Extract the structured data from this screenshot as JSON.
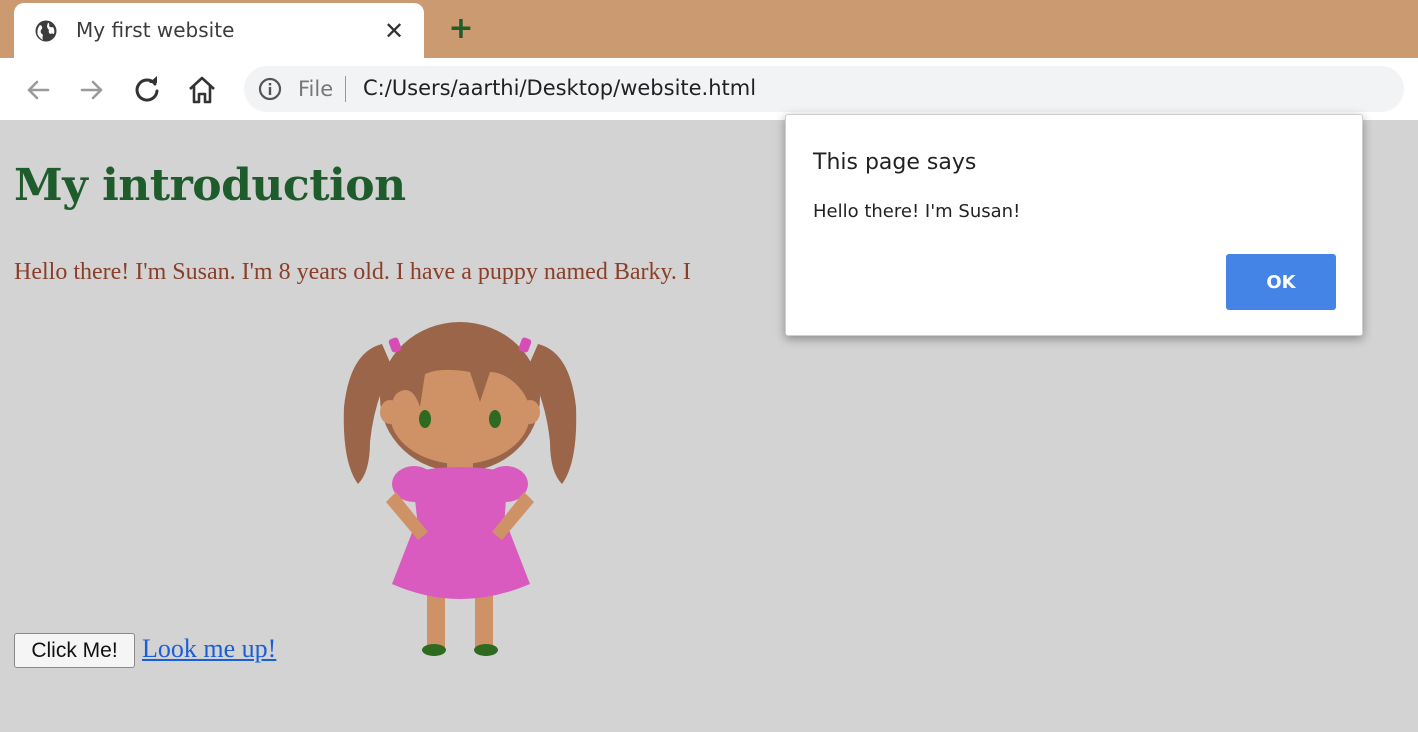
{
  "browser": {
    "tab": {
      "title": "My first website",
      "close_glyph": "✕",
      "icon": "globe-icon"
    },
    "new_tab_glyph": "+",
    "nav": {
      "back_icon": "back-arrow-icon",
      "forward_icon": "forward-arrow-icon",
      "reload_icon": "reload-icon",
      "home_icon": "home-icon"
    },
    "address": {
      "info_icon": "info-icon",
      "scheme": "File",
      "url": "C:/Users/aarthi/Desktop/website.html"
    },
    "colors": {
      "tabstrip": "#cc9a70",
      "toolbar": "#ffffff"
    }
  },
  "page": {
    "heading": "My introduction",
    "intro": "Hello there! I'm Susan. I'm 8 years old. I have a puppy named Barky. I",
    "image": "girl-illustration",
    "button_label": "Click Me!",
    "link_text": "Look me up!",
    "colors": {
      "background": "#d3d3d3",
      "heading": "#1e5c2c",
      "intro": "#8a3f2a",
      "link": "#1a5fd6"
    }
  },
  "dialog": {
    "title": "This page says",
    "message": "Hello there! I'm Susan!",
    "ok_label": "OK",
    "colors": {
      "ok_button": "#4384e6"
    }
  }
}
